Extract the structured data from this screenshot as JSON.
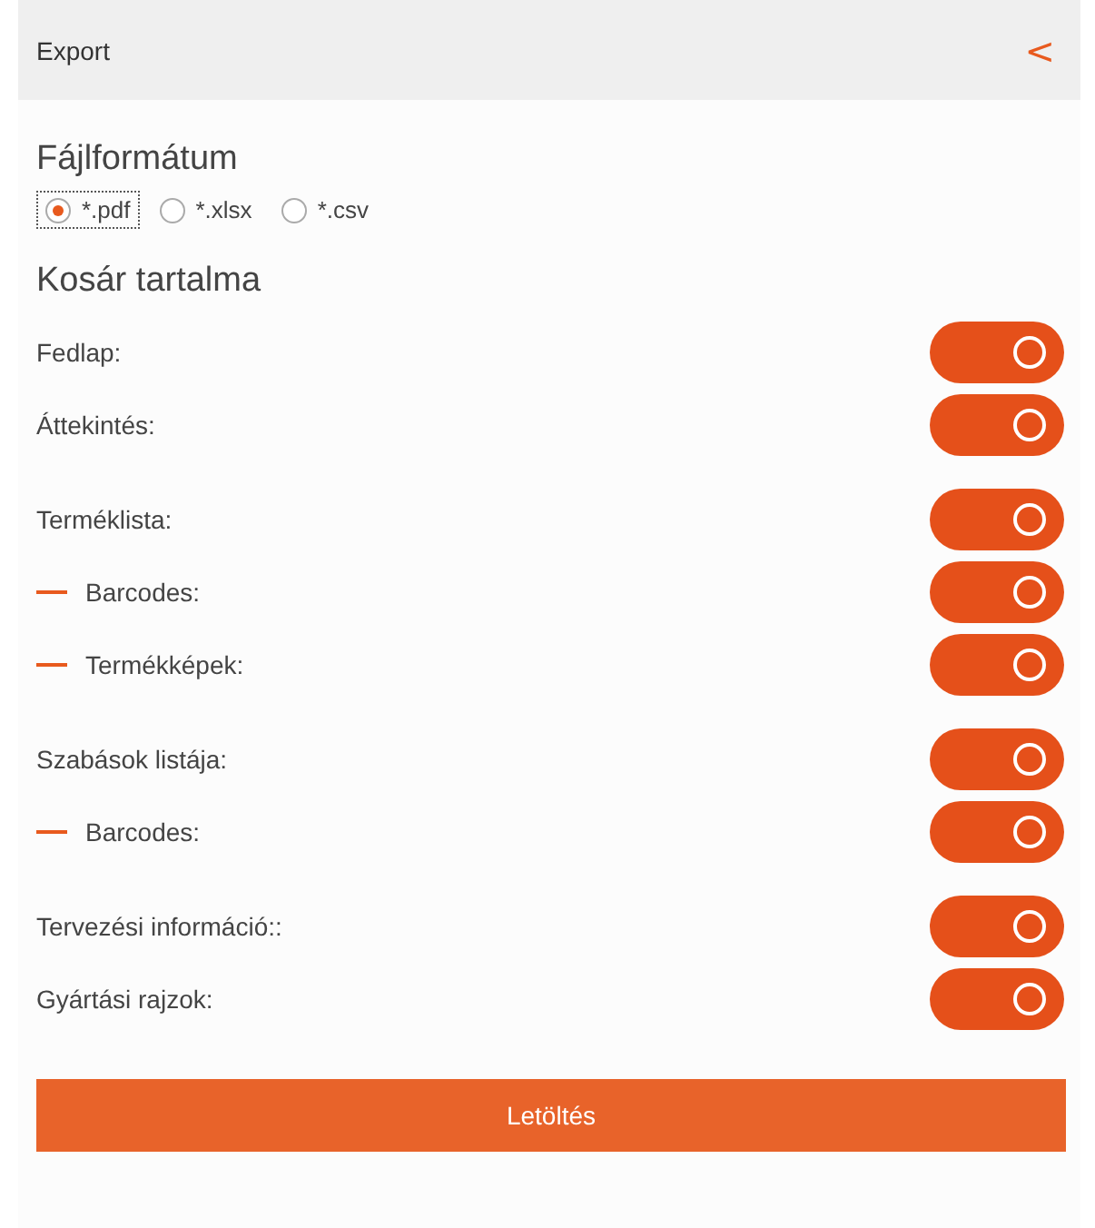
{
  "header": {
    "title": "Export",
    "back_glyph": "<"
  },
  "file_format": {
    "title": "Fájlformátum",
    "options": [
      {
        "label": "*.pdf",
        "selected": true
      },
      {
        "label": "*.xlsx",
        "selected": false
      },
      {
        "label": "*.csv",
        "selected": false
      }
    ]
  },
  "basket": {
    "title": "Kosár tartalma",
    "groups": [
      [
        {
          "label": "Fedlap:",
          "on": true
        },
        {
          "label": "Áttekintés:",
          "on": true
        }
      ],
      [
        {
          "label": "Terméklista:",
          "on": true,
          "children": [
            {
              "label": "Barcodes:",
              "on": true
            },
            {
              "label": "Termékképek:",
              "on": true
            }
          ]
        }
      ],
      [
        {
          "label": "Szabások listája:",
          "on": true,
          "children": [
            {
              "label": "Barcodes:",
              "on": true
            }
          ]
        }
      ],
      [
        {
          "label": "Tervezési információ::",
          "on": true
        },
        {
          "label": "Gyártási rajzok:",
          "on": true
        }
      ]
    ]
  },
  "download_button": "Letöltés"
}
